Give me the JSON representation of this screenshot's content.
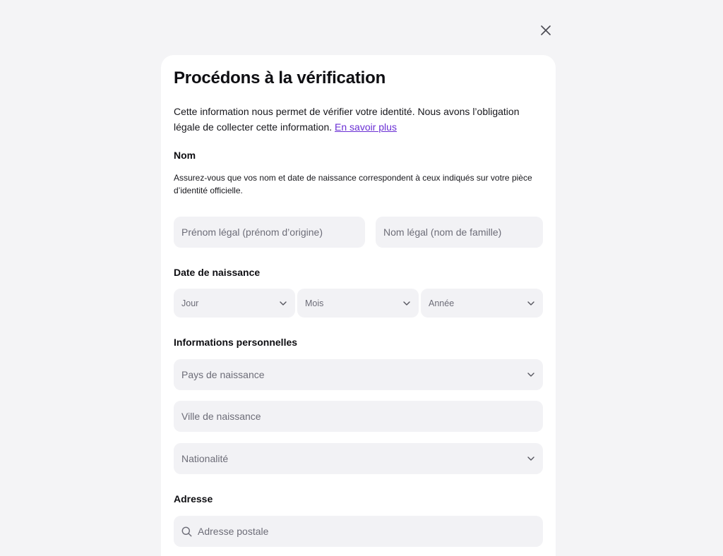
{
  "dialog": {
    "title": "Procédons à la vérification",
    "intro_text": "Cette information nous permet de vérifier votre identité. Nous avons l’obligation légale de collecter cette information. ",
    "learn_more_link": "En savoir plus"
  },
  "name_section": {
    "label": "Nom",
    "hint": "Assurez-vous que vos nom et date de naissance correspondent à ceux indiqués sur votre pièce d’identité officielle.",
    "first_name_placeholder": "Prénom légal (prénom d’origine)",
    "last_name_placeholder": "Nom légal (nom de famille)"
  },
  "birthdate_section": {
    "label": "Date de naissance",
    "day": "Jour",
    "month": "Mois",
    "year": "Année"
  },
  "personal_section": {
    "label": "Informations personnelles",
    "birth_country": "Pays de naissance",
    "birth_city_placeholder": "Ville de naissance",
    "nationality": "Nationalité"
  },
  "address_section": {
    "label": "Adresse",
    "postal_address_placeholder": "Adresse postale"
  },
  "icons": {
    "close": "close-icon",
    "chevron": "chevron-down-icon",
    "search": "search-icon"
  },
  "colors": {
    "background": "#f4f4f6",
    "card": "#ffffff",
    "field": "#f2f2f5",
    "link": "#6a2fd4",
    "placeholder": "#6d6d78"
  }
}
